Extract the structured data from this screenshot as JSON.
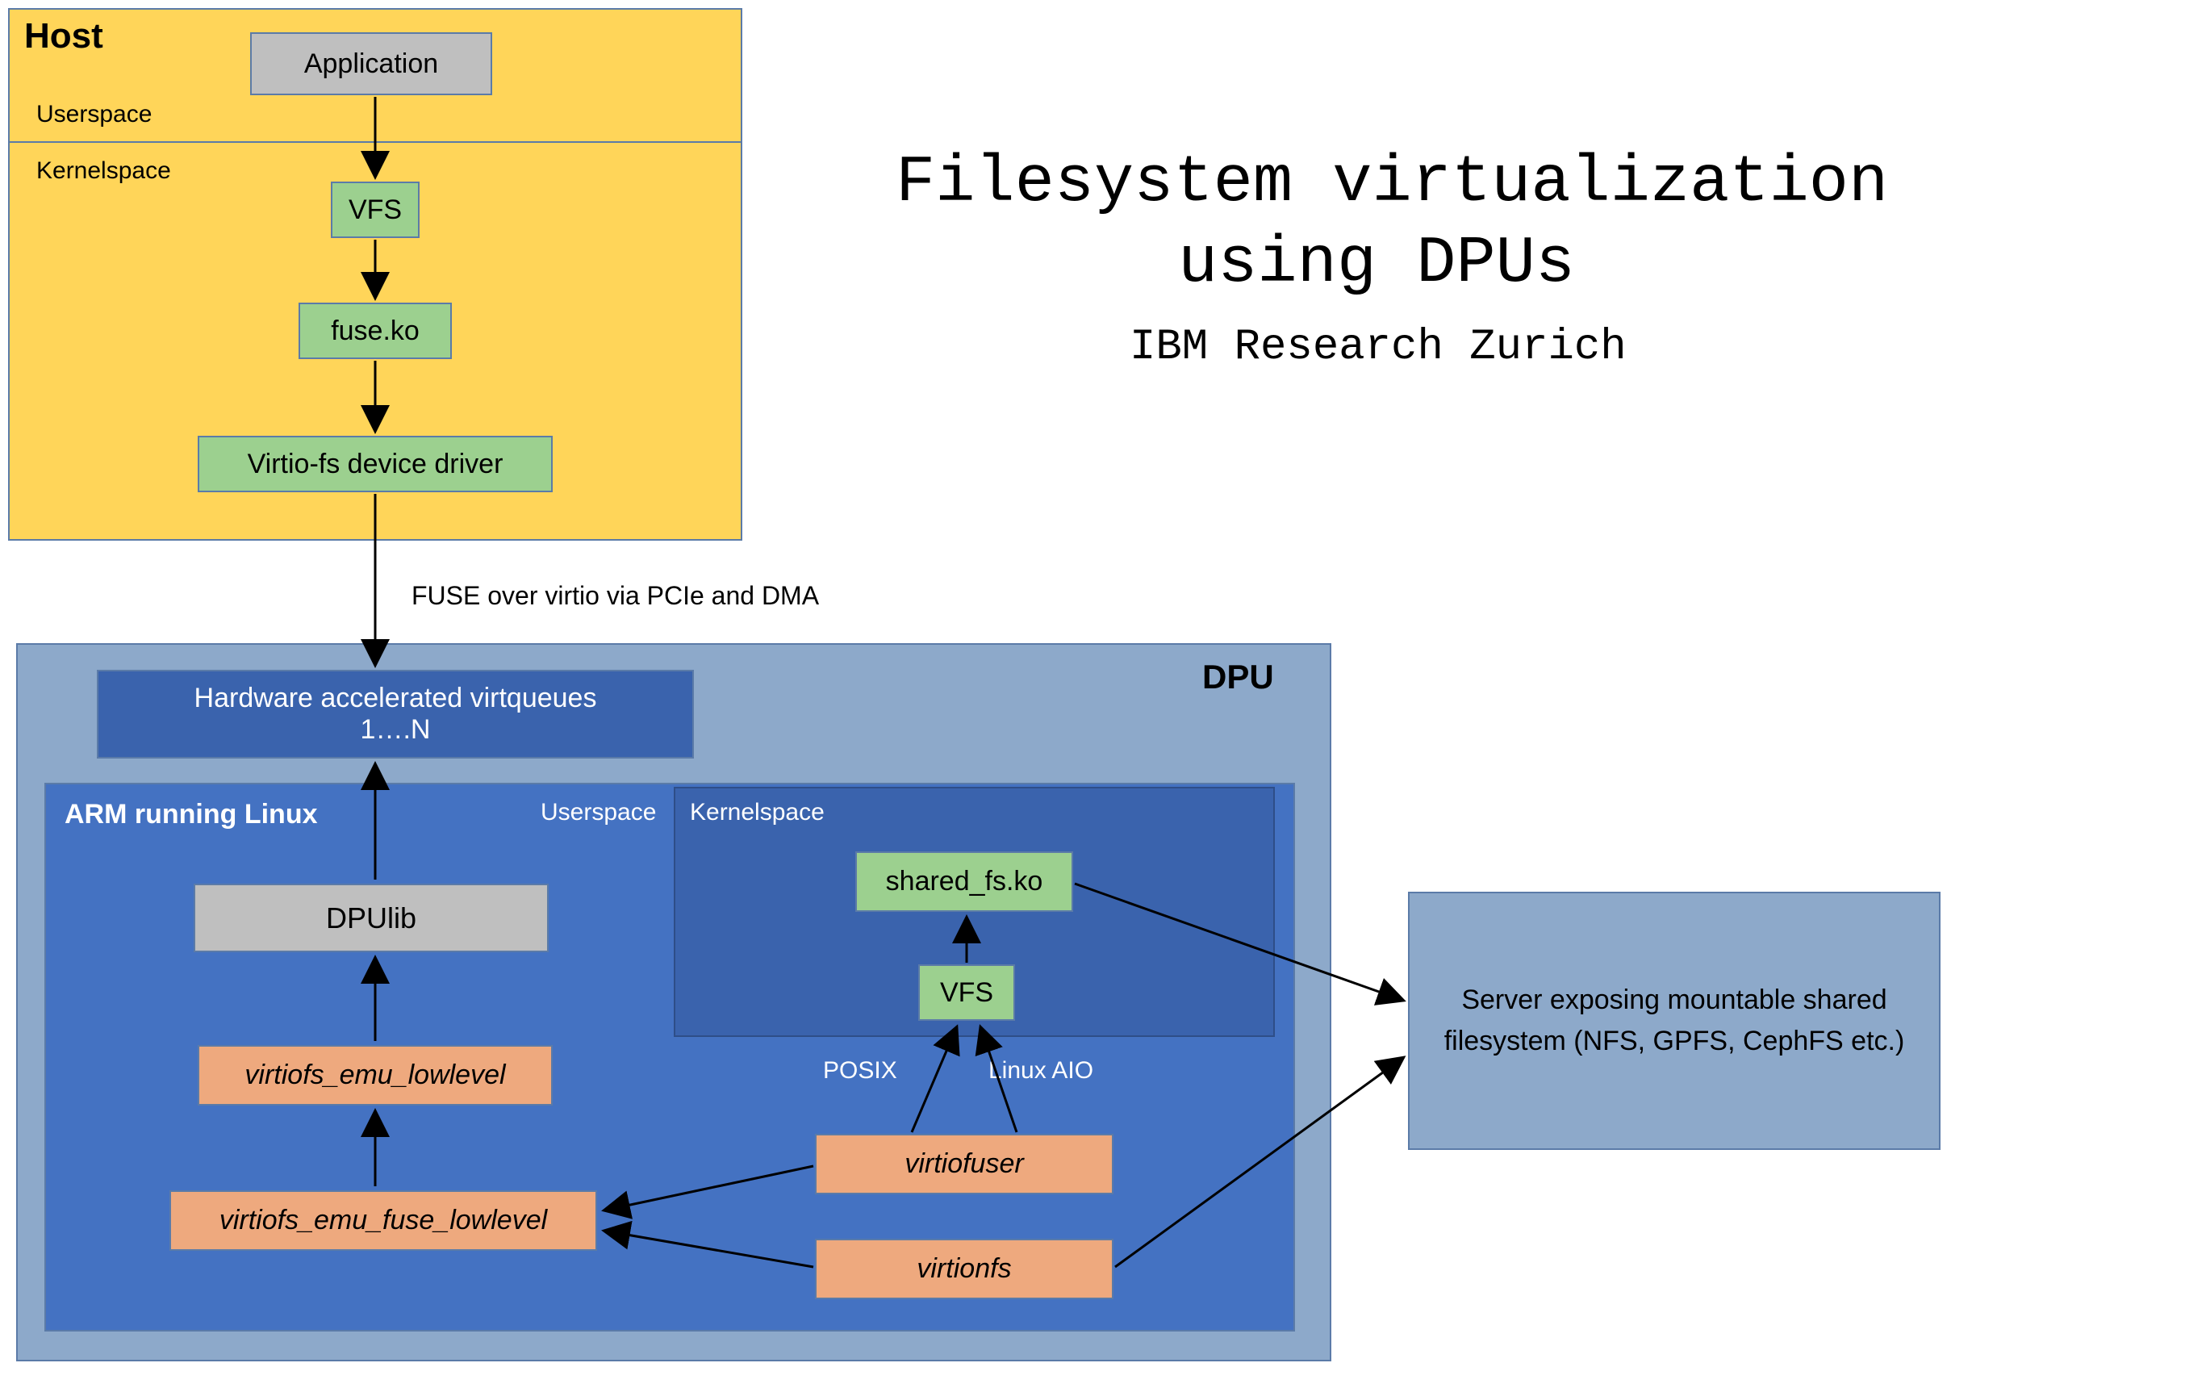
{
  "title": {
    "line1": "Filesystem virtualization",
    "line2": "using DPUs",
    "subtitle": "IBM Research Zurich"
  },
  "host": {
    "heading": "Host",
    "userspace": "Userspace",
    "kernelspace": "Kernelspace",
    "application": "Application",
    "vfs": "VFS",
    "fuse_ko": "fuse.ko",
    "virtio_driver": "Virtio-fs device driver"
  },
  "link": {
    "fuse_over_virtio": "FUSE over virtio via PCIe and DMA"
  },
  "dpu": {
    "heading": "DPU",
    "arm_heading": "ARM running Linux",
    "userspace": "Userspace",
    "kernelspace": "Kernelspace",
    "virtqueues_line1": "Hardware accelerated virtqueues",
    "virtqueues_line2": "1….N",
    "dpulib": "DPUlib",
    "virtiofs_emu_lowlevel": "virtiofs_emu_lowlevel",
    "virtiofs_emu_fuse_lowlevel": "virtiofs_emu_fuse_lowlevel",
    "shared_fs_ko": "shared_fs.ko",
    "vfs": "VFS",
    "posix": "POSIX",
    "linux_aio": "Linux AIO",
    "virtiofuser": "virtiofuser",
    "virtionfs": "virtionfs"
  },
  "server_box": {
    "line1": "Server exposing mountable shared",
    "line2": "filesystem (NFS, GPFS, CephFS etc.)"
  },
  "colors": {
    "host_bg": "#ffd559",
    "kernel_green": "#9cd08f",
    "gray_box": "#bfbfbf",
    "dpu_outer": "#8da9ca",
    "dpu_inner": "#4472c2",
    "dpu_dark": "#3a63ad",
    "orange": "#eea97e",
    "server_bg": "#8da9ca",
    "border": "#5b7ba8"
  }
}
